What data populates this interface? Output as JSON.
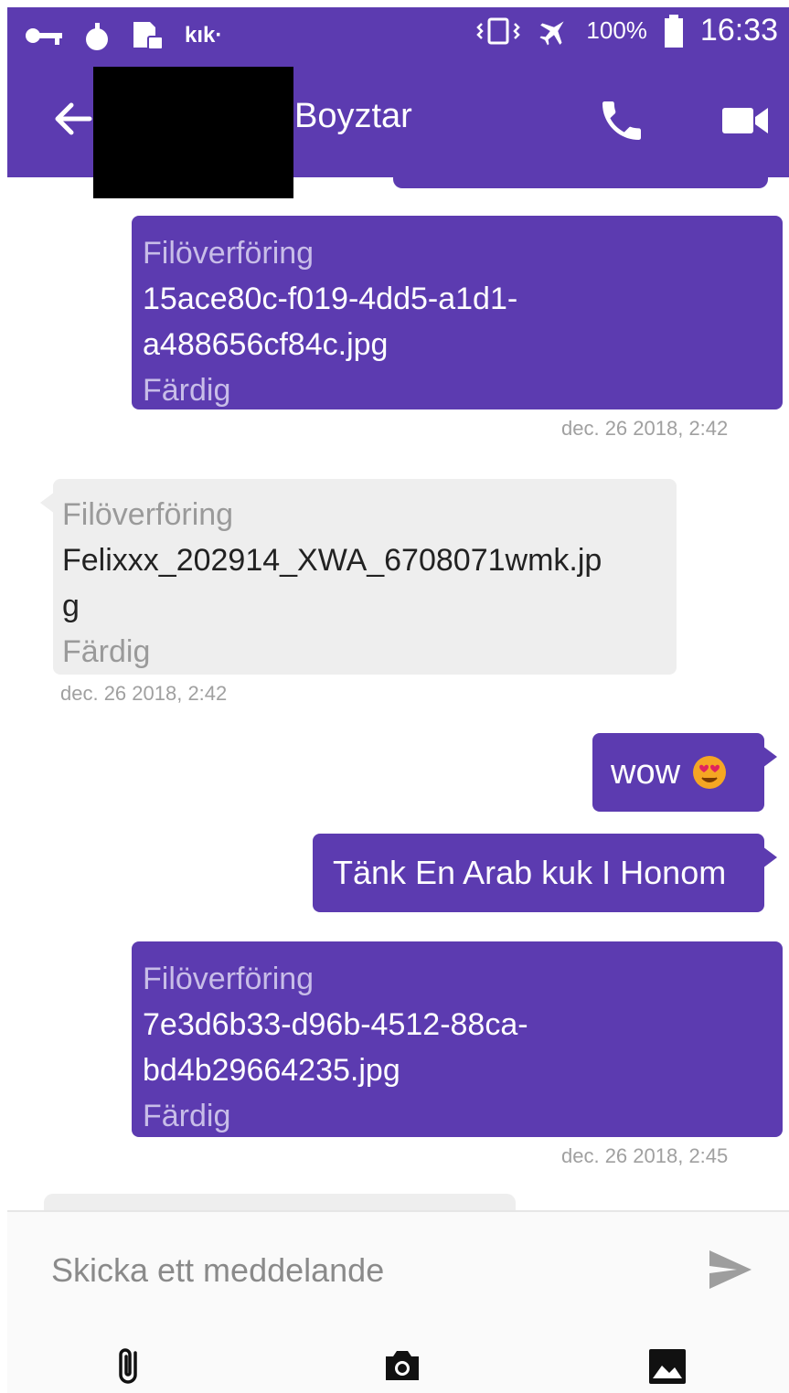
{
  "status_bar": {
    "kik_label": "kık·",
    "battery": "100%",
    "time": "16:33"
  },
  "header": {
    "title": "Boyztar"
  },
  "messages": [
    {
      "direction": "outgoing",
      "type": "file",
      "label": "Filöverföring",
      "filename_line1": "15ace80c-f019-4dd5-a1d1-",
      "filename_line2": "a488656cf84c.jpg",
      "status": "Färdig",
      "timestamp": "dec. 26 2018,  2:42"
    },
    {
      "direction": "incoming",
      "type": "file",
      "label": "Filöverföring",
      "filename_line1": "Felixxx_202914_XWA_6708071wmk.jp",
      "filename_line2": "g",
      "status": "Färdig",
      "timestamp": "dec. 26 2018,  2:42"
    },
    {
      "direction": "outgoing",
      "type": "text",
      "text": "wow",
      "emoji": "smiling-face-with-heart-eyes"
    },
    {
      "direction": "outgoing",
      "type": "text",
      "text": "Tänk En Arab kuk I Honom"
    },
    {
      "direction": "outgoing",
      "type": "file",
      "label": "Filöverföring",
      "filename_line1": "7e3d6b33-d96b-4512-88ca-",
      "filename_line2": "bd4b29664235.jpg",
      "status": "Färdig",
      "timestamp": "dec. 26 2018,  2:45"
    }
  ],
  "composer": {
    "placeholder": "Skicka ett meddelande"
  },
  "icons": [
    "key-icon",
    "bomb-icon",
    "sim-lock-icon",
    "vibrate-icon",
    "airplane-icon",
    "battery-icon",
    "back-arrow-icon",
    "phone-icon",
    "video-camera-icon",
    "send-icon",
    "attach-icon",
    "camera-icon",
    "gallery-icon"
  ],
  "colors": {
    "accent": "#5c3bb0",
    "incoming_bubble": "#eeeeee",
    "timestamp": "#a0a0a0"
  }
}
